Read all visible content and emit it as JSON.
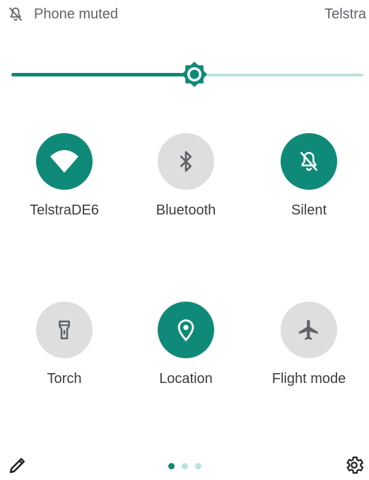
{
  "status_bar": {
    "muted_text": "Phone muted",
    "carrier": "Telstra"
  },
  "brightness": {
    "level": 0.52
  },
  "tiles": [
    {
      "label": "TelstraDE6",
      "icon": "wifi-icon",
      "active": true
    },
    {
      "label": "Bluetooth",
      "icon": "bluetooth-icon",
      "active": false
    },
    {
      "label": "Silent",
      "icon": "bell-off-icon",
      "active": true
    },
    {
      "label": "Torch",
      "icon": "flashlight-icon",
      "active": false
    },
    {
      "label": "Location",
      "icon": "location-pin-icon",
      "active": true
    },
    {
      "label": "Flight mode",
      "icon": "airplane-icon",
      "active": false
    }
  ],
  "pager": {
    "pages": 3,
    "current": 1
  },
  "colors": {
    "accent": "#0f8a78",
    "accent_light": "#b9e3dc",
    "tile_off": "#dedede",
    "icon_off": "#5f6368"
  }
}
